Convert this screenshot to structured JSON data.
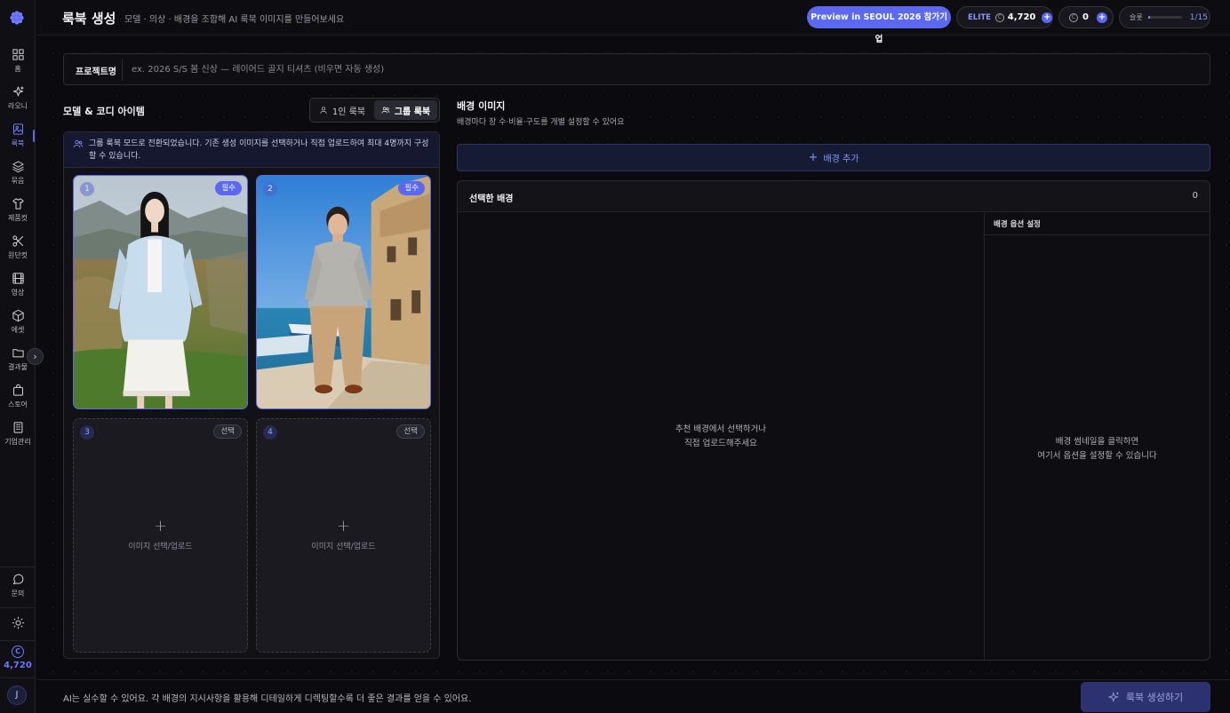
{
  "app": {
    "credits_side": "4,720",
    "avatar_initial": "J"
  },
  "sidebar": {
    "items": [
      {
        "label": "홈",
        "icon": "grid-icon"
      },
      {
        "label": "라오니",
        "icon": "sparkle-icon"
      },
      {
        "label": "룩북",
        "icon": "image-book-icon",
        "active": true
      },
      {
        "label": "묶음",
        "icon": "layers-icon"
      },
      {
        "label": "제품컷",
        "icon": "shirt-icon"
      },
      {
        "label": "원단컷",
        "icon": "scissors-icon"
      },
      {
        "label": "영상",
        "icon": "film-icon"
      },
      {
        "label": "에셋",
        "icon": "box-icon"
      },
      {
        "label": "결과물",
        "icon": "folder-icon"
      },
      {
        "label": "스토어",
        "icon": "bag-icon"
      },
      {
        "label": "기업관리",
        "icon": "building-icon"
      }
    ],
    "bottom": {
      "inquiry_label": "문의",
      "theme_icon": "sun-icon"
    }
  },
  "header": {
    "title": "룩북 생성",
    "subtitle": "모델 · 의상 · 배경을 조합해 AI 룩북 이미지를 만들어보세요",
    "preview_button": "Preview in SEOUL 2026 참가기업",
    "plan": "ELITE",
    "credits": "4,720",
    "points": "0",
    "slot_label": "슬롯",
    "slot_count": "1/15",
    "slot_fill": 0.07
  },
  "project": {
    "label": "프로젝트명",
    "placeholder": "ex. 2026 S/S 봄 신상 — 레이어드 골지 티셔츠 (비우면 자동 생성)",
    "value": ""
  },
  "models": {
    "title": "모델 & 코디 아이템",
    "toggle": {
      "single": "1인 룩북",
      "group": "그룹 룩북",
      "selected": "group"
    },
    "notice": "그룹 룩북 모드로 전환되었습니다. 기존 생성 이미지를 선택하거나 직접 업로드하여 최대 4명까지 구성할 수 있습니다.",
    "slots": [
      {
        "num": "1",
        "badge": "필수",
        "filled": true
      },
      {
        "num": "2",
        "badge": "필수",
        "filled": true
      },
      {
        "num": "3",
        "badge": "선택",
        "filled": false,
        "upload_label": "이미지 선택/업로드"
      },
      {
        "num": "4",
        "badge": "선택",
        "filled": false,
        "upload_label": "이미지 선택/업로드"
      }
    ]
  },
  "background": {
    "title": "배경 이미지",
    "subtitle": "배경마다 장 수·비율·구도를 개별 설정할 수 있어요",
    "add_button": "배경 추가",
    "selected_title": "선택한 배경",
    "selected_count": "0",
    "empty_line1": "추천 배경에서 선택하거나",
    "empty_line2": "직접 업로드해주세요",
    "options_title": "배경 옵션 설정",
    "options_line1": "배경 썸네일을 클릭하면",
    "options_line2": "여기서 옵션을 설정할 수 있습니다"
  },
  "footer": {
    "note": "AI는 실수할 수 있어요. 각 배경의 지시사항을 활용해 디테일하게 디렉팅할수록 더 좋은 결과를 얻을 수 있어요.",
    "generate_button": "룩북 생성하기"
  },
  "colors": {
    "accent": "#5b68f0",
    "background": "#0b0b0f",
    "panel": "#111116"
  }
}
